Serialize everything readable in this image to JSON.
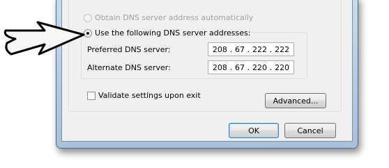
{
  "dns": {
    "auto_label": "Obtain DNS server address automatically",
    "manual_label": "Use the following DNS server addresses:",
    "preferred_label": "Preferred DNS server:",
    "alternate_label": "Alternate DNS server:",
    "preferred": [
      "208",
      "67",
      "222",
      "222"
    ],
    "alternate": [
      "208",
      "67",
      "220",
      "220"
    ]
  },
  "validate_label": "Validate settings upon exit",
  "buttons": {
    "advanced": "Advanced...",
    "ok": "OK",
    "cancel": "Cancel"
  },
  "colors": {
    "accent_border": "#3c7fb1",
    "dialog_bg": "#f0f0f0"
  },
  "icons": {
    "pointer": "arrow-right-icon"
  }
}
